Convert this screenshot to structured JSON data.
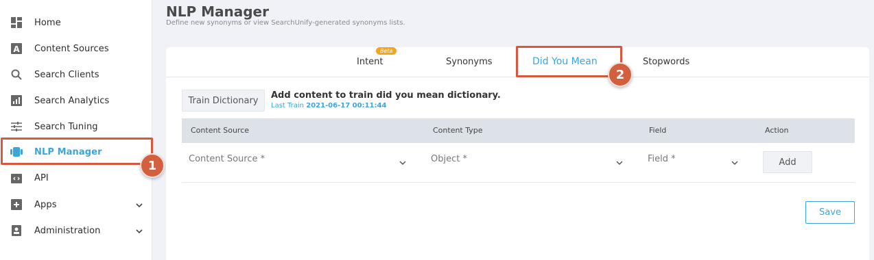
{
  "sidebar": {
    "items": [
      {
        "label": "Home",
        "icon": "dashboard-icon"
      },
      {
        "label": "Content Sources",
        "icon": "content-sources-icon"
      },
      {
        "label": "Search Clients",
        "icon": "search-icon"
      },
      {
        "label": "Search Analytics",
        "icon": "analytics-icon"
      },
      {
        "label": "Search Tuning",
        "icon": "sliders-icon"
      },
      {
        "label": "NLP Manager",
        "icon": "nlp-icon",
        "active": true
      },
      {
        "label": "API",
        "icon": "api-icon"
      },
      {
        "label": "Apps",
        "icon": "plus-square-icon",
        "expandable": true
      },
      {
        "label": "Administration",
        "icon": "admin-icon",
        "expandable": true
      }
    ]
  },
  "header": {
    "title": "NLP Manager",
    "subtitle": "Define new synonyms or view SearchUnify-generated synonyms lists."
  },
  "tabs": [
    {
      "label": "Intent",
      "badge": "Beta"
    },
    {
      "label": "Synonyms"
    },
    {
      "label": "Did You Mean",
      "active": true
    },
    {
      "label": "Stopwords"
    }
  ],
  "train": {
    "button_label": "Train Dictionary",
    "title": "Add content to train did you mean dictionary.",
    "last_train_label": "Last Train",
    "last_train_value": "2021-06-17 00:11:44"
  },
  "table": {
    "headers": [
      "Content Source",
      "Content Type",
      "Field",
      "Action"
    ],
    "row": {
      "content_source_placeholder": "Content Source *",
      "object_placeholder": "Object *",
      "field_placeholder": "Field *",
      "add_label": "Add"
    }
  },
  "save_label": "Save",
  "annotations": {
    "step1": "1",
    "step2": "2"
  },
  "colors": {
    "accent": "#3aa6dd",
    "highlight": "#d9573f",
    "beta": "#f4a623"
  }
}
